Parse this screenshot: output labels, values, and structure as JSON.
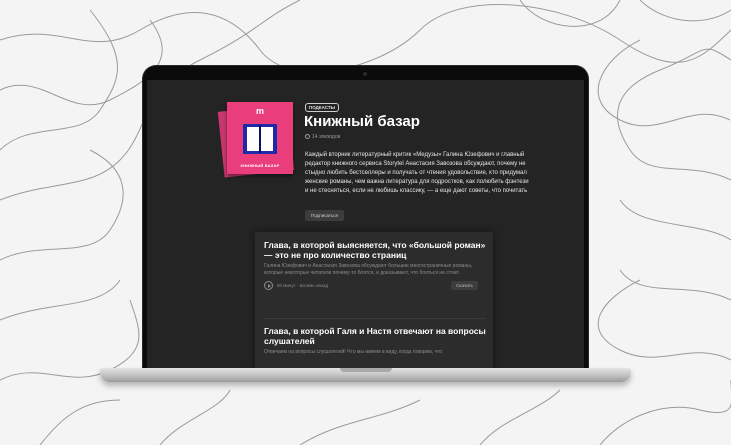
{
  "podcast": {
    "badge": "ПОДКАСТЫ",
    "title": "Книжный базар",
    "episodes_count": "14 эпизодов",
    "cover_logo": "m",
    "cover_label": "КНИЖНЫЙ БАЗАР",
    "description": "Каждый вторник литературный критик «Медузы» Галина Юзефович и главный редактор книжного сервиса Storytel Анастасия Завозова обсуждают, почему не стыдно любить бестселлеры и получать от чтения удовольствие, кто придумал женские романы, чем важна литература для подростков, как полюбить фэнтези и не стесняться, если не любишь классику, — а еще дают советы, что почитать",
    "subscribe_label": "Подписаться"
  },
  "episodes": [
    {
      "title": "Глава, в которой выясняется, что «большой роман» — это не про количество страниц",
      "description": "Галина Юзефович и Анастасия Завозова обсуждают большие многостраничные романы, которые некоторые читатели почему-то боятся, и доказывают, что бояться не стоит.",
      "meta": "60 минут · восемь назад",
      "download_label": "Скачать"
    },
    {
      "title": "Глава, в которой Галя и Настя отвечают на вопросы слушателей",
      "description": "Отвечаем на вопросы слушателей! Что мы имеем в виду, когда говорим, что"
    }
  ],
  "icons": {
    "play": "play-icon",
    "episodes": "headphones-icon"
  },
  "colors": {
    "cover_pink": "#e93d7c",
    "screen_bg": "#242424"
  }
}
